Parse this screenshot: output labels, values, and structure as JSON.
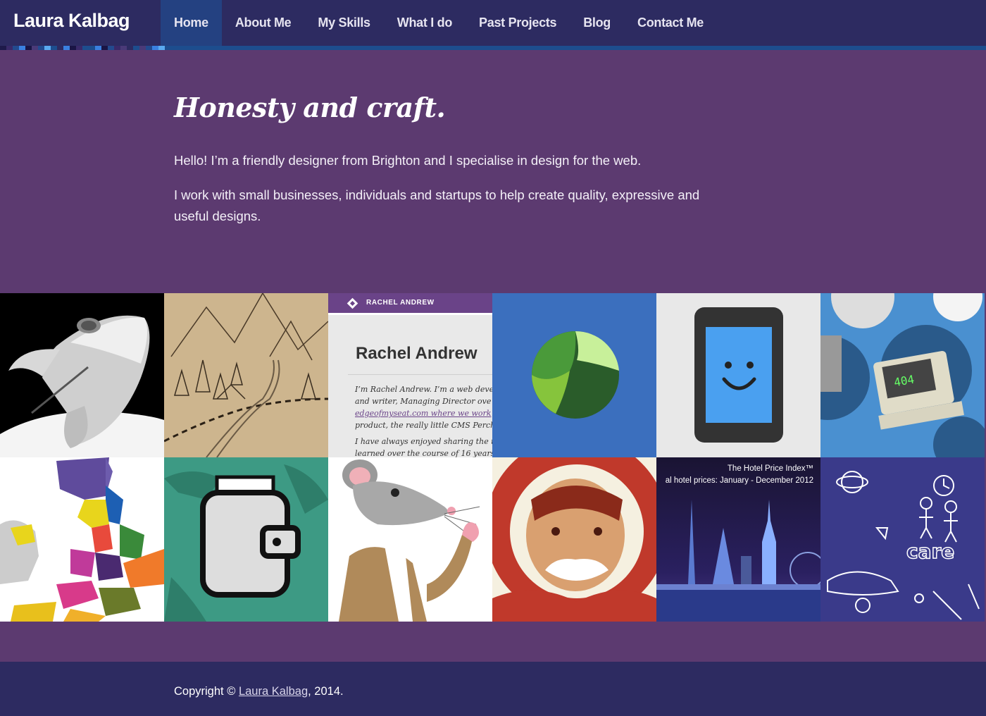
{
  "header": {
    "logo": "Laura Kalbag",
    "nav": [
      {
        "label": "Home",
        "active": true
      },
      {
        "label": "About Me",
        "active": false
      },
      {
        "label": "My Skills",
        "active": false
      },
      {
        "label": "What I do",
        "active": false
      },
      {
        "label": "Past Projects",
        "active": false
      },
      {
        "label": "Blog",
        "active": false
      },
      {
        "label": "Contact Me",
        "active": false
      }
    ]
  },
  "colors": {
    "header_bg": "#2d2b61",
    "nav_active_bg": "#244181",
    "page_bg": "#5c3a70",
    "strip_blue": "#1d4d8e"
  },
  "intro": {
    "heading": "Honesty and craft.",
    "paragraphs": [
      "Hello! I’m a friendly designer from Brighton and I specialise in design for the web.",
      "I work with small businesses, individuals and startups to help create quality, expressive and useful designs."
    ]
  },
  "portfolio": {
    "tiles": [
      {
        "name": "rocket",
        "icon": "rocket-icon"
      },
      {
        "name": "mountain-map",
        "icon": "map-sketch-icon"
      },
      {
        "name": "rachel-andrew",
        "header": "RACHEL ANDREW",
        "title": "Rachel Andrew",
        "text_lines": [
          "I’m Rachel Andrew. I’m a web deve",
          "and writer, Managing Director ove",
          "edgeofmyseat.com where we work",
          "product, the really little CMS Perch",
          "",
          "I have always enjoyed sharing the t",
          "learned over the course of 16 years"
        ]
      },
      {
        "name": "green-globe",
        "icon": "green-globe-icon"
      },
      {
        "name": "smiling-phone",
        "icon": "smiling-phone-icon"
      },
      {
        "name": "404-computers",
        "label": "404"
      },
      {
        "name": "uk-map",
        "icon": "uk-map-icon"
      },
      {
        "name": "wallet",
        "icon": "wallet-icon"
      },
      {
        "name": "mouse-character",
        "icon": "mouse-icon"
      },
      {
        "name": "astronaut",
        "icon": "astronaut-icon"
      },
      {
        "name": "hotel-price-index",
        "title": "The Hotel Price Index™",
        "subtitle": "al hotel prices: January - December 2012"
      },
      {
        "name": "care-doodles",
        "label": "care"
      }
    ]
  },
  "footer": {
    "prefix": "Copyright © ",
    "link": "Laura Kalbag",
    "suffix": ", 2014."
  }
}
